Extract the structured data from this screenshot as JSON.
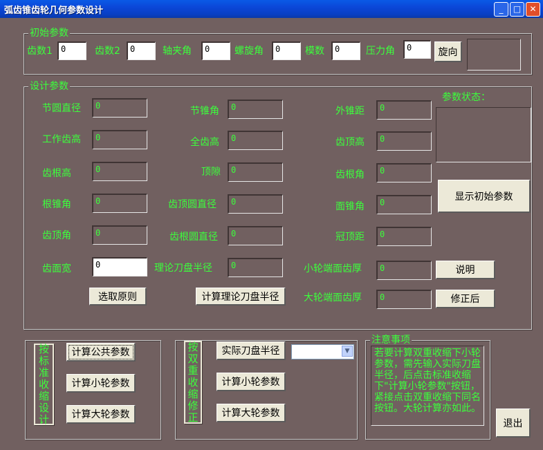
{
  "window": {
    "title": "弧齿锥齿轮几何参数设计",
    "min_glyph": "_",
    "max_glyph": "□",
    "close_glyph": "✕"
  },
  "initial_params": {
    "legend": "初始参数",
    "teeth1_label": "齿数1",
    "teeth1_value": "0",
    "teeth2_label": "齿数2",
    "teeth2_value": "0",
    "shaft_angle_label": "轴夹角",
    "shaft_angle_value": "0",
    "helix_angle_label": "螺旋角",
    "helix_angle_value": "0",
    "module_label": "模数",
    "module_value": "0",
    "pressure_angle_label": "压力角",
    "pressure_angle_value": "0",
    "rotation_button": "旋向"
  },
  "design_params": {
    "legend": "设计参数",
    "pitch_diameter": {
      "label": "节圆直径",
      "value": "0"
    },
    "pitch_cone_angle": {
      "label": "节锥角",
      "value": "0"
    },
    "outer_cone_distance": {
      "label": "外锥距",
      "value": "0"
    },
    "working_depth": {
      "label": "工作齿高",
      "value": "0"
    },
    "whole_depth": {
      "label": "全齿高",
      "value": "0"
    },
    "addendum": {
      "label": "齿顶高",
      "value": "0"
    },
    "dedendum": {
      "label": "齿根高",
      "value": "0"
    },
    "clearance": {
      "label": "顶隙",
      "value": "0"
    },
    "dedendum_angle": {
      "label": "齿根角",
      "value": "0"
    },
    "root_cone_angle": {
      "label": "根锥角",
      "value": "0"
    },
    "tip_diameter": {
      "label": "齿顶圆直径",
      "value": "0"
    },
    "face_cone_angle": {
      "label": "面锥角",
      "value": "0"
    },
    "addendum_angle": {
      "label": "齿顶角",
      "value": "0"
    },
    "root_diameter": {
      "label": "齿根圆直径",
      "value": "0"
    },
    "crown_distance": {
      "label": "冠顶距",
      "value": "0"
    },
    "face_width": {
      "label": "齿面宽",
      "value": "0"
    },
    "theoretical_cutter_radius": {
      "label": "理论刀盘半径",
      "value": "0"
    },
    "pinion_thickness": {
      "label": "小轮端面齿厚",
      "value": "0"
    },
    "gear_thickness": {
      "label": "大轮端面齿厚",
      "value": "0"
    },
    "status_label": "参数状态：",
    "show_initial_button": "显示初始参数",
    "explain_button": "说明",
    "revised_button": "修正后",
    "select_principle_button": "选取原则",
    "calc_cutter_button": "计算理论刀盘半径"
  },
  "standard_group": {
    "vertical_chars": [
      "按",
      "标",
      "准",
      "收",
      "缩",
      "设",
      "计"
    ],
    "calc_common_button": "计算公共参数",
    "calc_pinion_button": "计算小轮参数",
    "calc_gear_button": "计算大轮参数"
  },
  "double_group": {
    "vertical_chars": [
      "按",
      "双",
      "重",
      "收",
      "缩",
      "修",
      "正"
    ],
    "actual_cutter_button": "实际刀盘半径",
    "calc_pinion_button": "计算小轮参数",
    "calc_gear_button": "计算大轮参数"
  },
  "notes": {
    "legend": "注意事项",
    "text": "若要计算双重收缩下小轮参数，需先输入实际刀盘半径，后点击标准收缩下\"计算小轮参数\"按钮，紧接点击双重收缩下同名按钮。大轮计算亦如此。"
  },
  "exit_button": "退出"
}
